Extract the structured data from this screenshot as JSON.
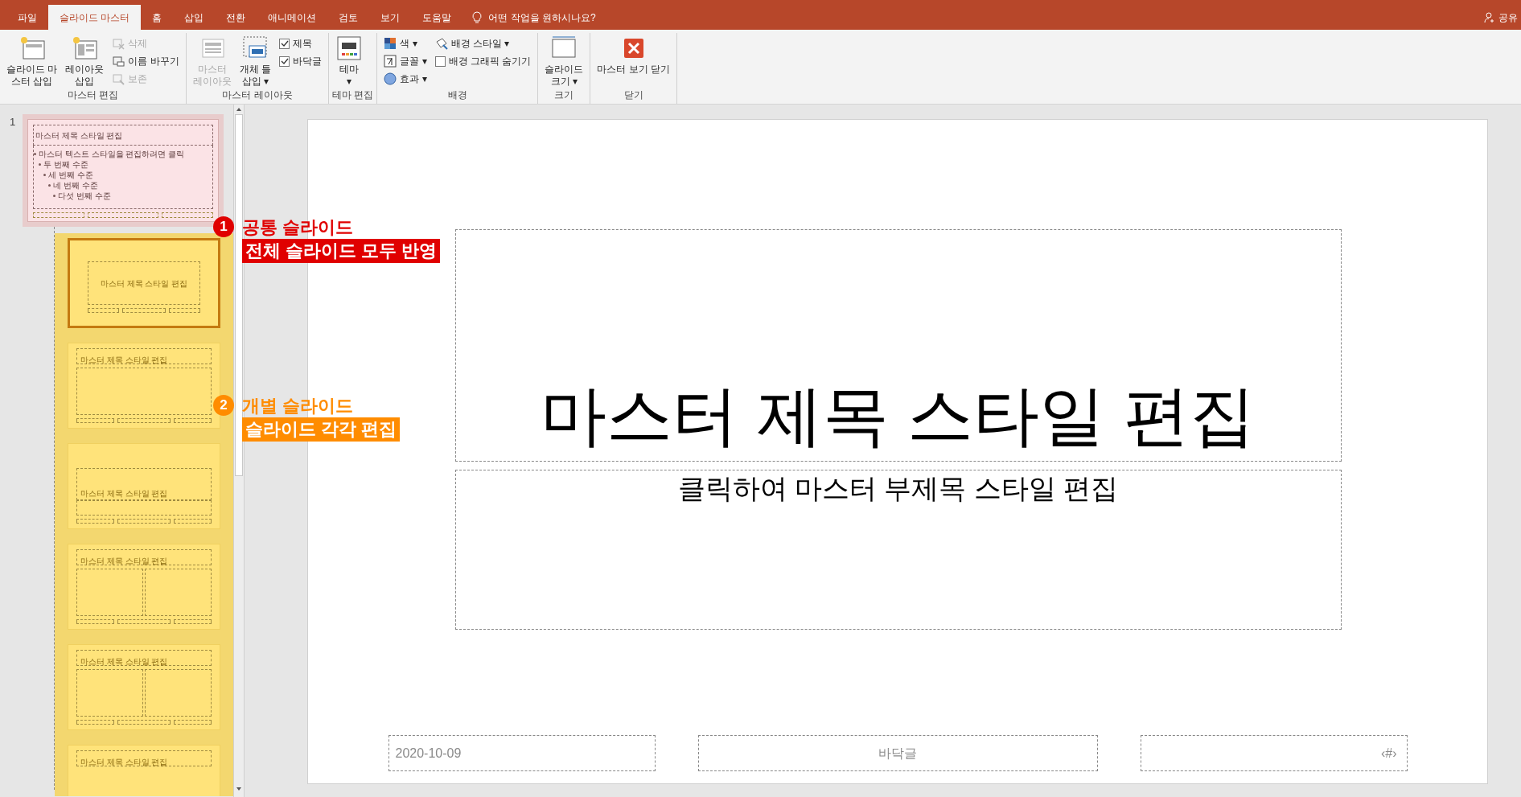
{
  "tabs": [
    {
      "label": "파일",
      "selected": false
    },
    {
      "label": "슬라이드 마스터",
      "selected": true
    },
    {
      "label": "홈",
      "selected": false
    },
    {
      "label": "삽입",
      "selected": false
    },
    {
      "label": "전환",
      "selected": false
    },
    {
      "label": "애니메이션",
      "selected": false
    },
    {
      "label": "검토",
      "selected": false
    },
    {
      "label": "보기",
      "selected": false
    },
    {
      "label": "도움말",
      "selected": false
    }
  ],
  "tell_me": "어떤 작업을 원하시나요?",
  "share": "공유",
  "ribbon": [
    {
      "label": "마스터 편집",
      "items": [
        {
          "kind": "big",
          "label": "슬라이드 마\n스터 삽입",
          "disabled": false
        },
        {
          "kind": "big",
          "label": "레이아웃\n삽입",
          "disabled": false
        },
        {
          "kind": "stack",
          "items": [
            {
              "kind": "small",
              "label": "삭제",
              "disabled": true
            },
            {
              "kind": "small",
              "label": "이름 바꾸기",
              "disabled": false
            },
            {
              "kind": "small",
              "label": "보존",
              "disabled": true
            }
          ]
        }
      ]
    },
    {
      "label": "마스터 레이아웃",
      "items": [
        {
          "kind": "big",
          "label": "마스터\n레이아웃",
          "disabled": true
        },
        {
          "kind": "big",
          "label": "개체 틀\n삽입 ▾",
          "disabled": false
        },
        {
          "kind": "stack",
          "items": [
            {
              "kind": "check",
              "label": "제목",
              "checked": true
            },
            {
              "kind": "check",
              "label": "바닥글",
              "checked": true
            }
          ]
        }
      ]
    },
    {
      "label": "테마 편집",
      "items": [
        {
          "kind": "big",
          "label": "테마\n▾",
          "disabled": false
        }
      ]
    },
    {
      "label": "배경",
      "items": [
        {
          "kind": "stack",
          "items": [
            {
              "kind": "small",
              "label": "색 ▾",
              "disabled": false
            },
            {
              "kind": "small",
              "label": "글꼴 ▾",
              "disabled": false
            },
            {
              "kind": "small",
              "label": "효과 ▾",
              "disabled": false
            }
          ]
        },
        {
          "kind": "stack",
          "items": [
            {
              "kind": "small",
              "label": "배경 스타일 ▾",
              "disabled": false
            },
            {
              "kind": "check",
              "label": "배경 그래픽 숨기기",
              "checked": false
            }
          ]
        }
      ]
    },
    {
      "label": "크기",
      "items": [
        {
          "kind": "big",
          "label": "슬라이드\n크기 ▾",
          "disabled": false
        }
      ]
    },
    {
      "label": "닫기",
      "items": [
        {
          "kind": "big",
          "label": "마스터 보기 닫기",
          "disabled": false
        }
      ]
    }
  ],
  "thumbnails": {
    "number": "1",
    "master": {
      "title": "마스터 제목 스타일 편집",
      "body": [
        {
          "text": "마스터 텍스트 스타일을 편집하려면 클릭",
          "children": [
            {
              "text": "두 번째 수준",
              "children": [
                {
                  "text": "세 번째 수준",
                  "children": [
                    {
                      "text": "네 번째 수준",
                      "children": [
                        {
                          "text": "다섯 번째 수준"
                        }
                      ]
                    }
                  ]
                }
              ]
            }
          ]
        }
      ]
    },
    "layouts": [
      {
        "kind": "title",
        "title": "마스터 제목 스타일 편집",
        "selected": true
      },
      {
        "kind": "content",
        "title": "마스터 제목 스타일 편집",
        "selected": false
      },
      {
        "kind": "section",
        "title": "마스터 제목 스타일 편집",
        "selected": false
      },
      {
        "kind": "two",
        "title": "마스터 제목 스타일 편집",
        "selected": false
      },
      {
        "kind": "comparison",
        "title": "마스터 제목 스타일 편집",
        "selected": false
      },
      {
        "kind": "title_only",
        "title": "마스터 제목 스타일 편집",
        "selected": false
      }
    ]
  },
  "callouts": [
    {
      "number": "1",
      "heading": "공통 슬라이드",
      "note": "전체 슬라이드 모두 반영",
      "color": "#e00000"
    },
    {
      "number": "2",
      "heading": "개별 슬라이드",
      "note": "슬라이드 각각 편집",
      "color": "#ff8c00"
    }
  ],
  "slide": {
    "title": "마스터 제목 스타일 편집",
    "subtitle": "클릭하여 마스터 부제목 스타일 편집",
    "date": "2020-10-09",
    "footer": "바닥글",
    "number": "‹#›"
  }
}
